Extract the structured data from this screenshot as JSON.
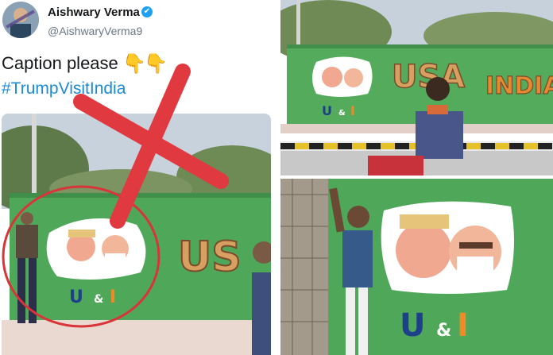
{
  "tweet": {
    "author_name": "Aishwary Verma",
    "author_handle": "@AishwaryVerma9",
    "caption": "Caption please",
    "hashtag": "#TrumpVisitIndia",
    "emojis": [
      "👇",
      "👇"
    ],
    "verified_badge": "✔"
  },
  "mural": {
    "usa_text": "USA",
    "india_text": "INDIA",
    "us_text": "US",
    "u_letter": "U",
    "amp": "&",
    "i_letter": "I"
  },
  "colors": {
    "wall_green": "#4fa85a",
    "cross_red": "#e0393f",
    "circle_red": "#d8343a",
    "hashtag_blue": "#1b8bd9",
    "verified_blue": "#1da1f2"
  },
  "icons": {
    "verified": "verified-check-icon",
    "pointing_down": "pointing-down-emoji",
    "cross": "red-x-mark"
  }
}
